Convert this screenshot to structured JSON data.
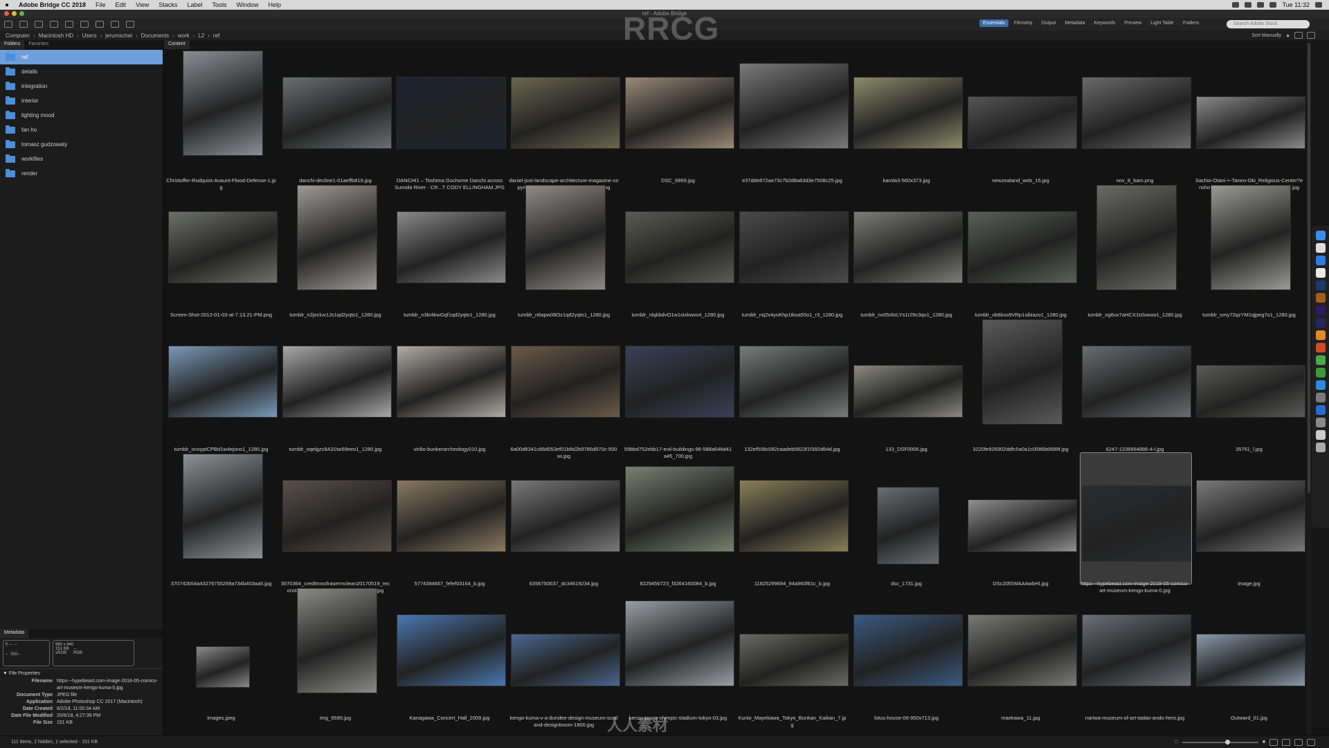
{
  "menubar": {
    "apple": "",
    "app_name": "Adobe Bridge CC 2018",
    "items": [
      "File",
      "Edit",
      "View",
      "Stacks",
      "Label",
      "Tools",
      "Window",
      "Help"
    ],
    "clock": "Tue 11:32"
  },
  "window": {
    "title": "ref - Adobe Bridge"
  },
  "workspaces": {
    "items": [
      "Essentials",
      "Filmstrip",
      "Output",
      "Metadata",
      "Keywords",
      "Preview",
      "Light Table",
      "Folders"
    ],
    "active": "Essentials",
    "search_placeholder": "Search Adobe Stock"
  },
  "path": {
    "crumbs": [
      "Computer",
      "Macintosh HD",
      "Users",
      "jerumschel",
      "Documents",
      "work",
      "L2",
      "ref"
    ],
    "sort_label": "Sort Manually"
  },
  "folders_panel": {
    "tabs": [
      "Folders",
      "Favorites"
    ],
    "items": [
      "ref",
      "details",
      "integration",
      "interior",
      "lighting mood",
      "fan ho",
      "tomasz gudzowaty",
      "workfiles",
      "render"
    ],
    "selected": "ref"
  },
  "metadata_panel": {
    "tab": "Metadata",
    "summary_left": [
      "f/ --",
      "--",
      "--",
      "ISO--"
    ],
    "summary_right": [
      "960 x 640",
      "151 KB",
      "--",
      "sRGB",
      "RGB"
    ],
    "section_title": "File Properties",
    "rows": [
      {
        "k": "Filename",
        "v": "https---hypebeast.com-image-2018-05-comico-art-museum-kengo-kuma-0.jpg"
      },
      {
        "k": "Document Type",
        "v": "JPEG file"
      },
      {
        "k": "Application",
        "v": "Adobe Photoshop CC 2017 (Macintosh)"
      },
      {
        "k": "Date Created",
        "v": "6/2/18, 11:00:34 AM"
      },
      {
        "k": "Date File Modified",
        "v": "20/6/18, 4:27:39 PM"
      },
      {
        "k": "File Size",
        "v": "151 KB"
      }
    ]
  },
  "content": {
    "tab": "Content",
    "items": [
      {
        "name": "Christoffer-Rudquist-Avaunt-Flood-Defense-1.jpg",
        "tone": "#8a8e94",
        "shape": "portrait"
      },
      {
        "name": "danchi-decline1-01aeffb819.jpg",
        "tone": "#6b6e70",
        "shape": "land"
      },
      {
        "name": "DANCHI1 – Toshima Gochome Danchi across Sumida River - CR...T CODY ELLINGHAM.JPG",
        "tone": "#1c2230",
        "shape": "land"
      },
      {
        "name": "daniel-jost-landscape-architecture-magazine-copyright_famous...s--digest-_797x530.jpg",
        "tone": "#6a6650",
        "shape": "land"
      },
      {
        "name": "DSC_6869.jpg",
        "tone": "#9a8a78",
        "shape": "land"
      },
      {
        "name": "e37dde872ae73c7b2d8a63d3e7508c25.jpg",
        "tone": "#7a7a7a",
        "shape": "land-tall"
      },
      {
        "name": "karola3-560x373.jpg",
        "tone": "#8a8c6a",
        "shape": "land"
      },
      {
        "name": "newzealand_web_15.jpg",
        "tone": "#555555",
        "shape": "land-short"
      },
      {
        "name": "nov_8_bam.png",
        "tone": "#6a6a6a",
        "shape": "land"
      },
      {
        "name": "Sachio-Otani-+-Taneo-Oki_Religious-Center?ensho-Kotai-Jingu-...jpg_dezeen_1000_9.jpg",
        "tone": "#8a8a8a",
        "shape": "land-short"
      },
      {
        "name": "Screen-Shot-2012-01-03-at-7.13.21-PM.png",
        "tone": "#6e7068",
        "shape": "land"
      },
      {
        "name": "tumblr_n2jocluv1Js1qd2yqto1_1280.jpg",
        "tone": "#9c9a96",
        "shape": "portrait"
      },
      {
        "name": "tumblr_n3kt4kwGqf1qd2yqto1_1280.jpg",
        "tone": "#8a8a8a",
        "shape": "land"
      },
      {
        "name": "tumblr_n6apw08Oz1qd2yqto1_1280.jpg",
        "tone": "#8e8c88",
        "shape": "portrait"
      },
      {
        "name": "tumblr_nlqkbdvO1w1sixkwvo4_1280.jpg",
        "tone": "#5a5c52",
        "shape": "land"
      },
      {
        "name": "tumblr_nq2x4yoKhp1tkoa55o1_r3_1280.jpg",
        "tone": "#4a4a4a",
        "shape": "land"
      },
      {
        "name": "tumblr_nx05r8zLYs1r29c3qo1_1280.jpg",
        "tone": "#7c7c7a",
        "shape": "land"
      },
      {
        "name": "tumblr_ob6kso9VRp1sibiazo1_1280.jpg",
        "tone": "#5a6058",
        "shape": "land"
      },
      {
        "name": "tumblr_og6uv7aHCX1tzluwoo1_1280.jpg",
        "tone": "#6a6a66",
        "shape": "portrait"
      },
      {
        "name": "tumblr_omy72qzYM1qjpeg7o1_1280.jpg",
        "tone": "#9a9a96",
        "shape": "portrait"
      },
      {
        "name": "tumblr_onxyptCPBd1w4ejono1_1280.jpg",
        "tone": "#7a9ab8",
        "shape": "land"
      },
      {
        "name": "tumblr_oqelgzc8A31tw59eeo1_1280.jpg",
        "tone": "#a8a8a8",
        "shape": "land"
      },
      {
        "name": "virilio-bunkerarcheology010.jpg",
        "tone": "#b0aca6",
        "shape": "land"
      },
      {
        "name": "6a00d8341c86d053ef01b8d2b9786d970c-500wi.jpg",
        "tone": "#6a5a48",
        "shape": "land"
      },
      {
        "name": "59bbd752ebb17-evil-buildings-96-588a646d41a45_700.jpg",
        "tone": "#3a4058",
        "shape": "land"
      },
      {
        "name": "132ef508c082caadeb5823f1f392d64d.jpg",
        "tone": "#7a7c7c",
        "shape": "land"
      },
      {
        "name": "133_DSF0006.jpg",
        "tone": "#8a8a80",
        "shape": "land-short"
      },
      {
        "name": "3220fe926902ddfc5a0a1c0086b6689f.jpg",
        "tone": "#5a5a5a",
        "shape": "portrait"
      },
      {
        "name": "6247-1336664886-4-l.jpg",
        "tone": "#6a6c6e",
        "shape": "land"
      },
      {
        "name": "35761_l.jpg",
        "tone": "#5a5a58",
        "shape": "land-short"
      },
      {
        "name": "370742b54a43276755269a734b403aa5.jpg",
        "tone": "#8e9296",
        "shape": "portrait"
      },
      {
        "name": "3070364_creditrossfrasermclean20170519_reconstruction_rossfrasermclean_6312_0.jpg",
        "tone": "#5a5048",
        "shape": "land"
      },
      {
        "name": "5774394667_fefef03164_b.jpg",
        "tone": "#8a7a60",
        "shape": "land"
      },
      {
        "name": "6356750637_dc34619234.jpg",
        "tone": "#7a7a7a",
        "shape": "land"
      },
      {
        "name": "8229456723_f3264160084_b.jpg",
        "tone": "#7a8070",
        "shape": "land-tall"
      },
      {
        "name": "11825299694_94a960f61c_b.jpg",
        "tone": "#8a8058",
        "shape": "land"
      },
      {
        "name": "dsc_1731.jpg",
        "tone": "#6a6e72",
        "shape": "portrait-short"
      },
      {
        "name": "DSc20fSWAAAwbHI.jpg",
        "tone": "#909090",
        "shape": "land-short"
      },
      {
        "name": "https---hypebeast.com-image-2018-05-comico-art-museum-kengo-kuma-0.jpg",
        "tone": "#2a2c2e",
        "shape": "selected"
      },
      {
        "name": "image.jpg",
        "tone": "#7a7a7a",
        "shape": "land"
      },
      {
        "name": "images.jpeg",
        "tone": "#8a8a8a",
        "shape": "small"
      },
      {
        "name": "img_9590.jpg",
        "tone": "#8a8a88",
        "shape": "portrait"
      },
      {
        "name": "Kanagawa_Concert_Hall_2009.jpg",
        "tone": "#4a78b0",
        "shape": "land"
      },
      {
        "name": "kengo-kuma-v-a-dundee-design-museum-scotland-designboom-1800.jpg",
        "tone": "#4a6890",
        "shape": "land-short"
      },
      {
        "name": "kenzo-tange-olympic-stadium-tokyo-03.jpg",
        "tone": "#9a9ea4",
        "shape": "land-tall"
      },
      {
        "name": "Kunio_Mayekawa_Tokyo_Bunkan_Kaikan_7.jpg",
        "tone": "#6a6a66",
        "shape": "land-short"
      },
      {
        "name": "lotus-house-06-950x713.jpg",
        "tone": "#3a5a80",
        "shape": "land"
      },
      {
        "name": "maekawa_11.jpg",
        "tone": "#7a7a78",
        "shape": "land"
      },
      {
        "name": "nariwa-museum-of-art-tadao-ando-hero.jpg",
        "tone": "#6a7078",
        "shape": "land"
      },
      {
        "name": "Outward_01.jpg",
        "tone": "#8a9aaa",
        "shape": "land-short"
      }
    ]
  },
  "status": {
    "text": "111 items, 2 hidden, 1 selected - 151 KB"
  },
  "watermark": {
    "logo": "RRCG",
    "bottom_text": "人人素材"
  },
  "colors": {
    "accent": "#3a6aa8",
    "selected_folder": "#6e9fd8",
    "folder_icon": "#4a8fd8"
  }
}
